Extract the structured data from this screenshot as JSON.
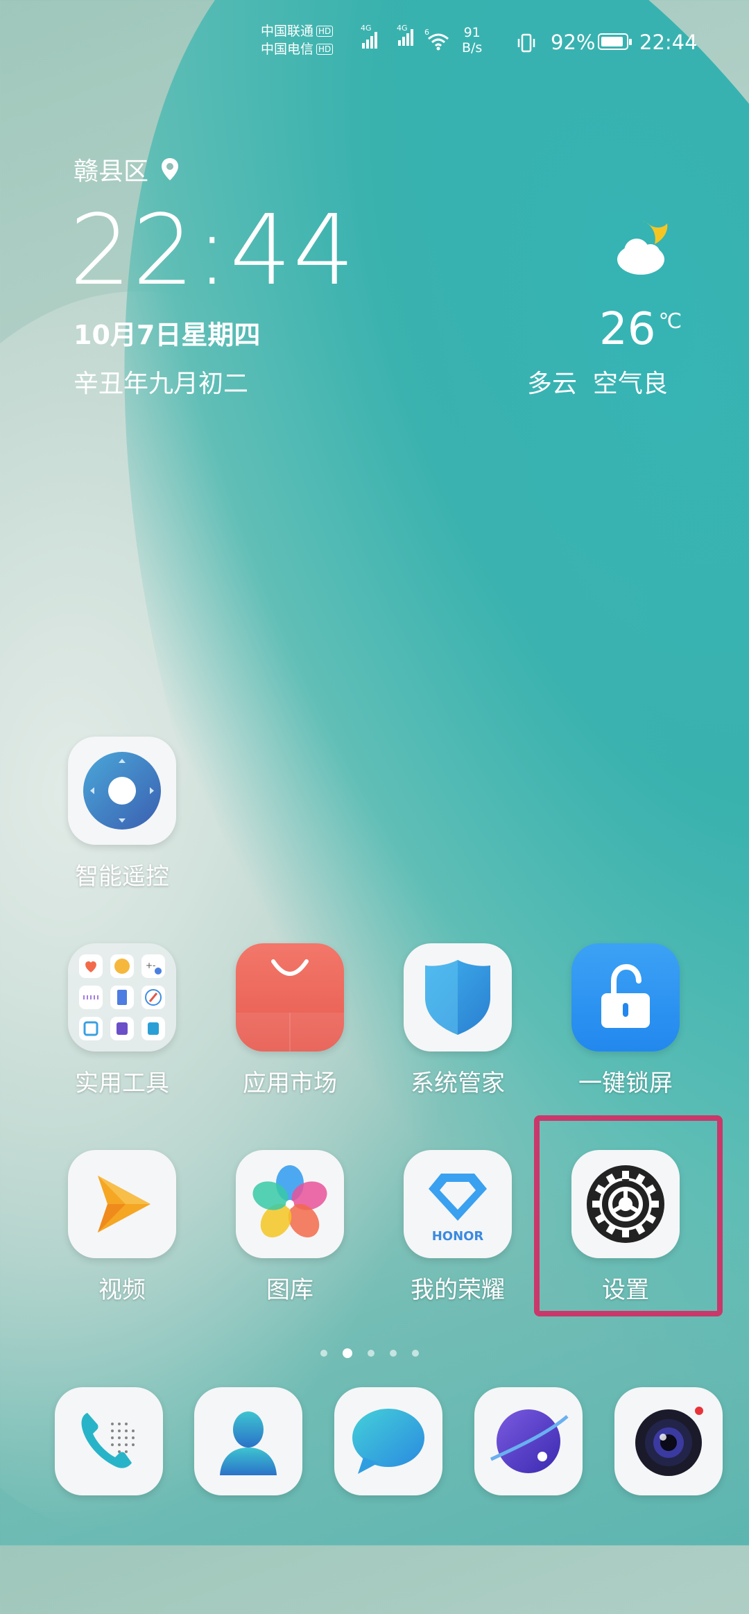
{
  "status_bar": {
    "carrier1": "中国联通",
    "carrier2": "中国电信",
    "hd": "HD",
    "net1": "4G",
    "net2": "4G",
    "wifi_badge": "6",
    "speed_value": "91",
    "speed_unit": "B/s",
    "battery_percent": "92%",
    "battery_level": 0.92,
    "time": "22:44"
  },
  "widget": {
    "location": "赣县区",
    "time": "22:44",
    "date": "10月7日星期四",
    "lunar": "辛丑年九月初二",
    "temperature": "26",
    "temp_unit": "℃",
    "condition": "多云",
    "air": "空气良",
    "weather_icon": "cloudy-night-icon"
  },
  "apps": {
    "remote": "智能遥控",
    "tools": "实用工具",
    "market": "应用市场",
    "manager": "系统管家",
    "lock": "一键锁屏",
    "video": "视频",
    "gallery": "图库",
    "honor": "我的荣耀",
    "honor_text": "HONOR",
    "settings": "设置"
  },
  "dock": [
    "phone-icon",
    "contacts-icon",
    "messages-icon",
    "browser-icon",
    "camera-icon"
  ],
  "page_indicator": {
    "count": 5,
    "active": 1
  },
  "colors": {
    "highlight": "#c9386a",
    "wave": "#2fb2b3"
  }
}
